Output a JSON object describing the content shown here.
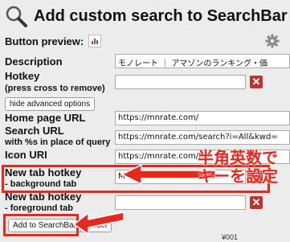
{
  "header": {
    "title": "Add custom search to SearchBar"
  },
  "preview": {
    "label": "Button preview:"
  },
  "form": {
    "description": {
      "label": "Description",
      "value": "モノレート ｜ アマゾンのランキング・価"
    },
    "hotkey": {
      "label": "Hotkey",
      "sublabel": "(press cross to remove)",
      "value": ""
    },
    "advanced_button": "hide advanced options",
    "homepage": {
      "label": "Home page URL",
      "value": "https://mnrate.com/"
    },
    "search_url": {
      "label": "Search URL",
      "sublabel": "with %s in place of query",
      "value": "https://mnrate.com/search?i=All&kwd="
    },
    "icon_uri": {
      "label": "Icon URI",
      "value": "https://mnrate.com/f"
    },
    "bg_hotkey": {
      "label": "New tab hotkey",
      "sublabel": "- background tab",
      "value": "M"
    },
    "fg_hotkey": {
      "label": "New tab hotkey",
      "sublabel": "- foreground tab",
      "value": ""
    },
    "add_button": "Add to SearchBar",
    "cancel_button": "Cancel"
  },
  "annotation": {
    "line1": "半角英数で",
    "line2": "キーを設定"
  },
  "background_text": "¥001",
  "colors": {
    "accent_red": "#e8271f",
    "clear_button": "#b8372f"
  }
}
